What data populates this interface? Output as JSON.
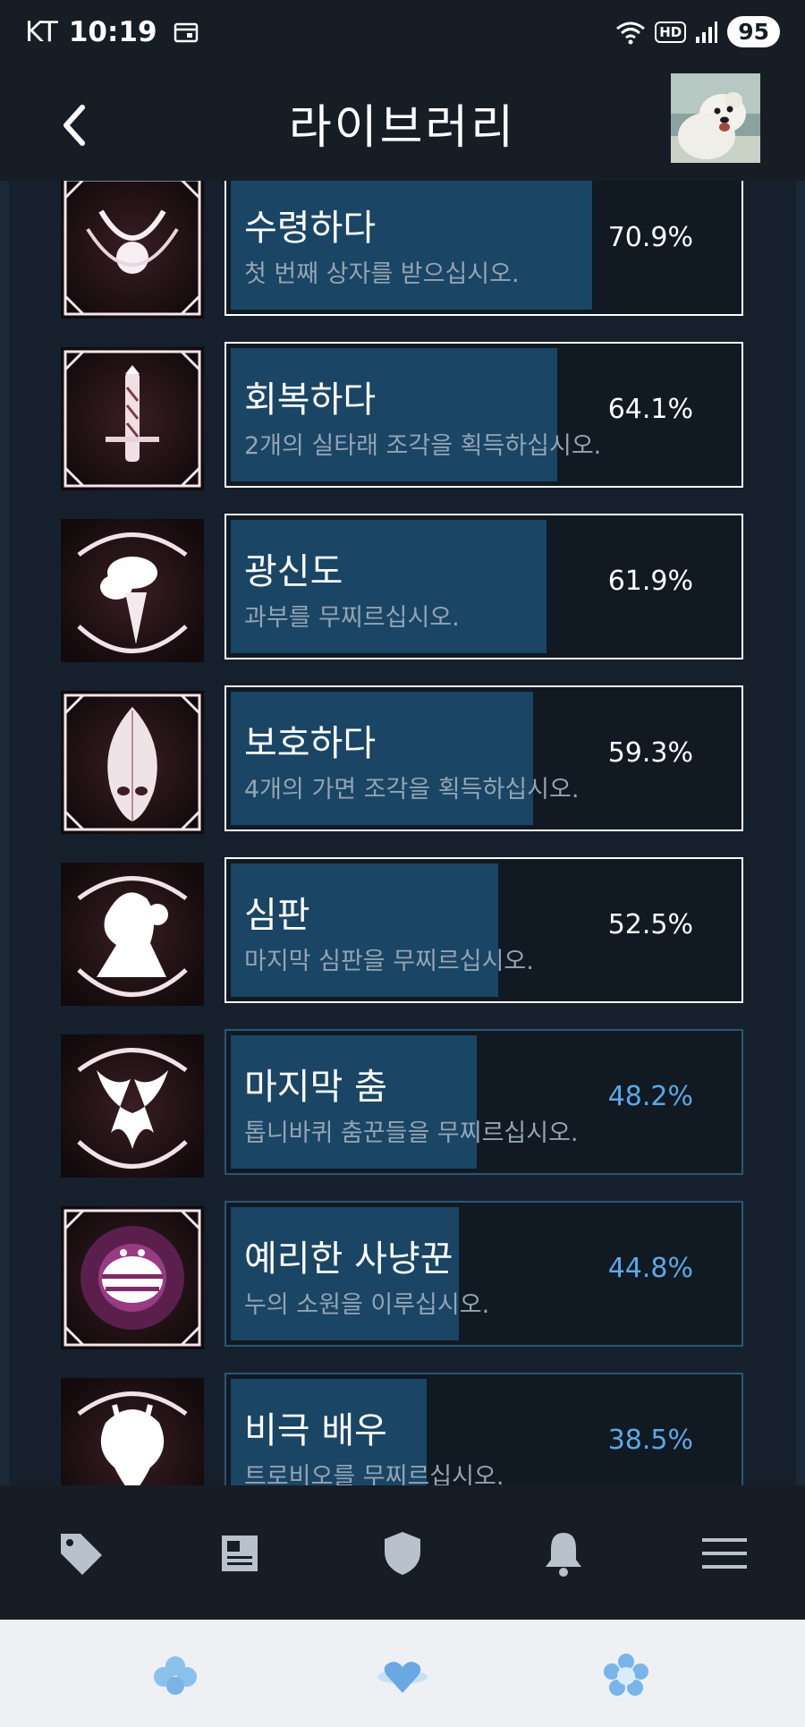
{
  "status_bar": {
    "carrier": "KT",
    "time": "10:19",
    "hd_label": "HD",
    "battery": "95"
  },
  "header": {
    "title": "라이브러리",
    "back_icon": "chevron-left-icon",
    "avatar_icon": "dog-avatar"
  },
  "achievements": [
    {
      "name": "수령하다",
      "description": "첫 번째 상자를 받으십시오.",
      "percent": "70.9%",
      "fill": 0.709,
      "unlocked": true,
      "icon": "crescent-orb-emblem"
    },
    {
      "name": "회복하다",
      "description": "2개의 실타래 조각을 획득하십시오.",
      "percent": "64.1%",
      "fill": 0.641,
      "unlocked": true,
      "icon": "spool-needle-emblem"
    },
    {
      "name": "광신도",
      "description": "과부를 무찌르십시오.",
      "percent": "61.9%",
      "fill": 0.619,
      "unlocked": true,
      "icon": "widow-silhouette"
    },
    {
      "name": "보호하다",
      "description": "4개의 가면 조각을 획득하십시오.",
      "percent": "59.3%",
      "fill": 0.593,
      "unlocked": true,
      "icon": "mask-shard-emblem"
    },
    {
      "name": "심판",
      "description": "마지막 심판을 무찌르십시오.",
      "percent": "52.5%",
      "fill": 0.525,
      "unlocked": true,
      "icon": "judge-silhouette"
    },
    {
      "name": "마지막 춤",
      "description": "톱니바퀴 춤꾼들을 무찌르십시오.",
      "percent": "48.2%",
      "fill": 0.482,
      "unlocked": false,
      "icon": "dancers-silhouette"
    },
    {
      "name": "예리한 사냥꾼",
      "description": "누의 소원을 이루십시오.",
      "percent": "44.8%",
      "fill": 0.448,
      "unlocked": false,
      "icon": "glowing-beetle-emblem"
    },
    {
      "name": "비극 배우",
      "description": "트로비오를 무찌르십시오.",
      "percent": "38.5%",
      "fill": 0.385,
      "unlocked": false,
      "icon": "tragedian-silhouette"
    }
  ],
  "bottom_nav": [
    "tag-icon",
    "news-icon",
    "shield-icon",
    "bell-icon",
    "menu-icon"
  ],
  "system_nav": [
    "clover-icon",
    "heart-icon",
    "flower-icon"
  ],
  "colors": {
    "background": "#171d25",
    "card_fill": "#1a4565",
    "locked_border": "#2a5676",
    "locked_percent": "#5aa9e6"
  }
}
